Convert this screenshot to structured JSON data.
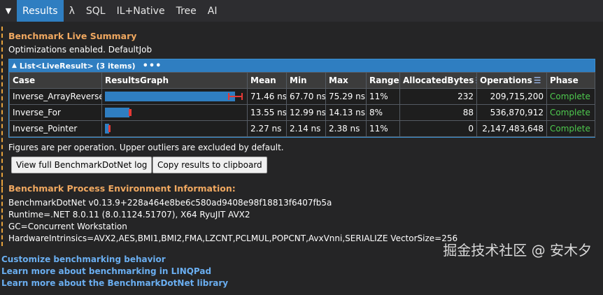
{
  "tabs": {
    "caret": "▼",
    "results": "Results",
    "lambda": "λ",
    "sql": "SQL",
    "il": "IL+Native",
    "tree": "Tree",
    "ai": "AI"
  },
  "summary": {
    "title": "Benchmark Live Summary",
    "options": "Optimizations enabled.  DefaultJob",
    "list_caption": "List<LiveResult> (3 items)",
    "list_menu": "•••",
    "columns": {
      "case": "Case",
      "graph": "ResultsGraph",
      "mean": "Mean",
      "min": "Min",
      "max": "Max",
      "range": "Range",
      "alloc": "AllocatedBytes",
      "ops": "Operations",
      "phase": "Phase"
    },
    "rows": [
      {
        "case": "Inverse_ArrayReverse",
        "mean": "71.46 ns",
        "min": "67.70 ns",
        "max": "75.29 ns",
        "range": "11%",
        "alloc": "232",
        "ops": "209,715,200",
        "phase": "Complete",
        "graph_mean": 71.46,
        "graph_min": 67.7,
        "graph_max": 75.29
      },
      {
        "case": "Inverse_For",
        "mean": "13.55 ns",
        "min": "12.99 ns",
        "max": "14.13 ns",
        "range": "8%",
        "alloc": "88",
        "ops": "536,870,912",
        "phase": "Complete",
        "graph_mean": 13.55,
        "graph_min": 12.99,
        "graph_max": 14.13
      },
      {
        "case": "Inverse_Pointer",
        "mean": "2.27 ns",
        "min": "2.14 ns",
        "max": "2.38 ns",
        "range": "11%",
        "alloc": "0",
        "ops": "2,147,483,648",
        "phase": "Complete",
        "graph_mean": 2.27,
        "graph_min": 2.14,
        "graph_max": 2.38
      }
    ],
    "note": "Figures are per operation. Upper outliers are excluded by default.",
    "btn_log": "View full BenchmarkDotNet log",
    "btn_copy": "Copy results to clipboard"
  },
  "env": {
    "title": "Benchmark Process Environment Information:",
    "line1": "BenchmarkDotNet v0.13.9+228a464e8be6c580ad9408e98f18813f6407fb5a",
    "line2": "Runtime=.NET 8.0.11 (8.0.1124.51707), X64 RyuJIT AVX2",
    "line3": "GC=Concurrent Workstation",
    "line4": "HardwareIntrinsics=AVX2,AES,BMI1,BMI2,FMA,LZCNT,PCLMUL,POPCNT,AvxVnni,SERIALIZE VectorSize=256"
  },
  "links": {
    "l1": "Customize benchmarking behavior",
    "l2": "Learn more about benchmarking in LINQPad",
    "l3": "Learn more about the BenchmarkDotNet library"
  },
  "watermark": "掘金技术社区 @ 安木夕",
  "colors": {
    "accent": "#2f7ec1",
    "section_title": "#f0a860",
    "complete": "#4ec94e",
    "error_bar": "#e53935",
    "link": "#6aaef0"
  }
}
